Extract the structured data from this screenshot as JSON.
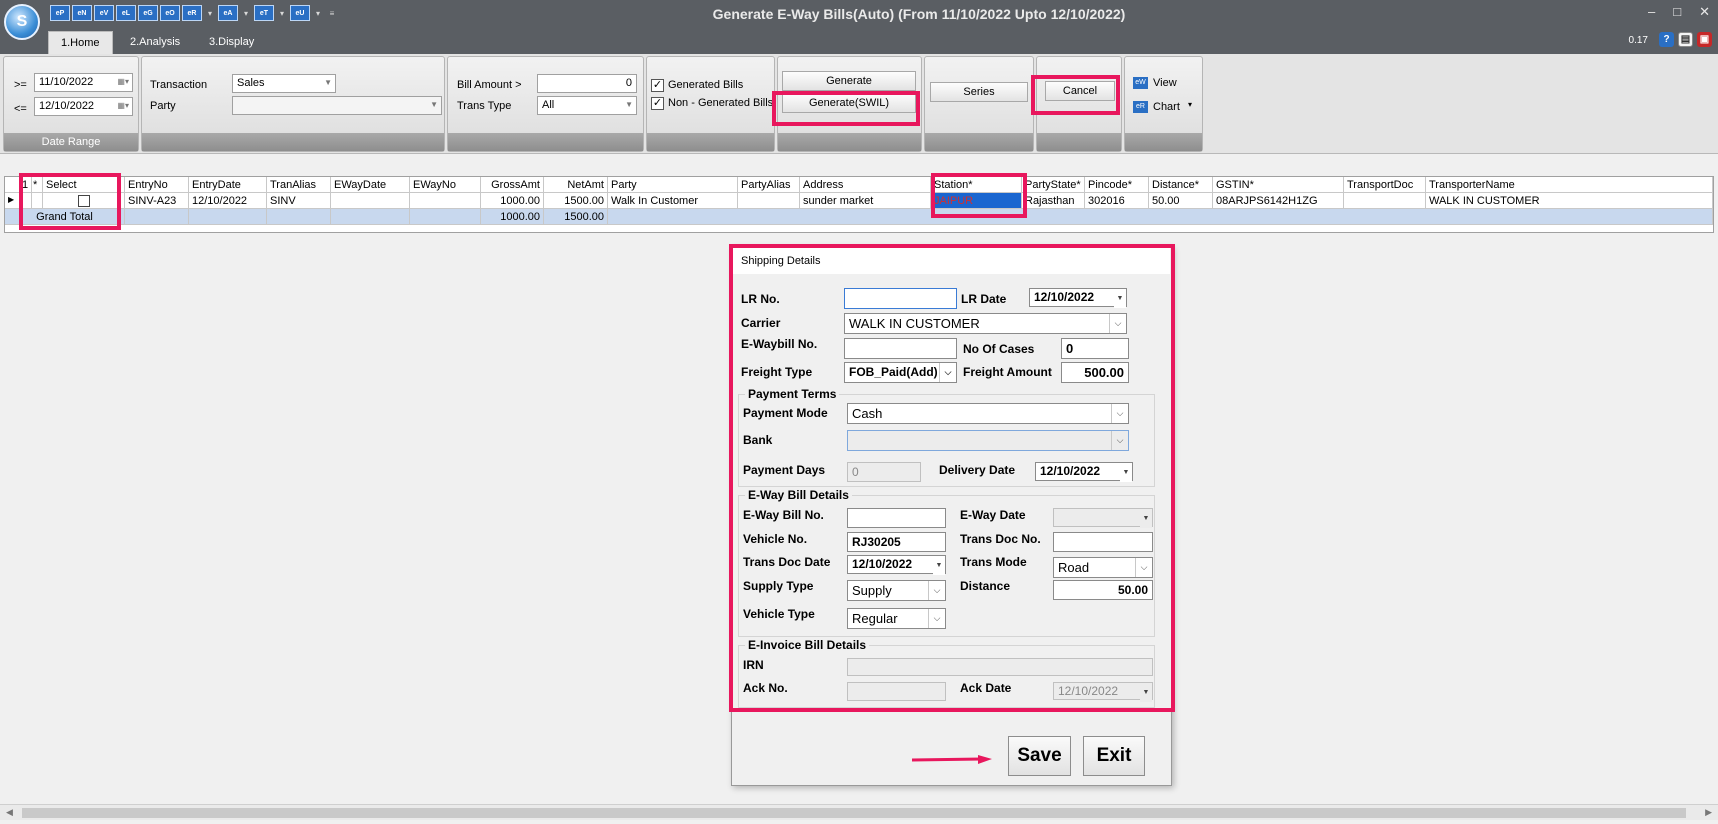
{
  "app": {
    "logo_letter": "S",
    "window_title": "Generate E-Way Bills(Auto) (From 11/10/2022 Upto 12/10/2022)",
    "version": "0.17",
    "quick_access": [
      "eP",
      "eN",
      "eV",
      "eL",
      "eG",
      "eO",
      "eR",
      "eA",
      "eT",
      "eU"
    ]
  },
  "tabs": [
    "1.Home",
    "2.Analysis",
    "3.Display"
  ],
  "ribbon": {
    "date_range": {
      "from_op": ">=",
      "from": "11/10/2022",
      "to_op": "<=",
      "to": "12/10/2022",
      "label": "Date Range"
    },
    "transaction_label": "Transaction",
    "transaction_value": "Sales",
    "party_label": "Party",
    "party_value": "",
    "bill_amount_label": "Bill Amount >",
    "bill_amount_value": "0",
    "trans_type_label": "Trans Type",
    "trans_type_value": "All",
    "generated_label": "Generated Bills",
    "non_generated_label": "Non - Generated Bills",
    "check_mark": "✓",
    "generate_label": "Generate",
    "generate_swil_label": "Generate(SWIL)",
    "series_label": "Series",
    "cancel_label": "Cancel",
    "view_label": "View",
    "chart_label": "Chart"
  },
  "grid": {
    "row_marker": "1",
    "star": "*",
    "columns": [
      "Select",
      "EntryNo",
      "EntryDate",
      "TranAlias",
      "EWayDate",
      "EWayNo",
      "GrossAmt",
      "NetAmt",
      "Party",
      "PartyAlias",
      "Address",
      "Station*",
      "PartyState*",
      "Pincode*",
      "Distance*",
      "GSTIN*",
      "TransportDoc",
      "TransporterName"
    ],
    "row": {
      "entry_no": "SINV-A23",
      "entry_date": "12/10/2022",
      "tran_alias": "SINV",
      "eway_date": "",
      "eway_no": "",
      "gross_amt": "1000.00",
      "net_amt": "1500.00",
      "party": "Walk In Customer",
      "party_alias": "",
      "address": "sunder market",
      "station": "JAIPUR",
      "party_state": "Rajasthan",
      "pincode": "302016",
      "distance": "50.00",
      "gstin": "08ARJPS6142H1ZG",
      "transport_doc": "",
      "transporter_name": "WALK IN CUSTOMER"
    },
    "grand_total": {
      "label": "Grand Total",
      "gross": "1000.00",
      "net": "1500.00"
    }
  },
  "dialog": {
    "title": "Shipping Details",
    "lr_no_label": "LR No.",
    "lr_no": "",
    "lr_date_label": "LR Date",
    "lr_date": "12/10/2022",
    "carrier_label": "Carrier",
    "carrier": "WALK IN CUSTOMER",
    "ewaybill_no_label": "E-Waybill No.",
    "ewaybill_no": "",
    "no_of_cases_label": "No Of Cases",
    "no_of_cases": "0",
    "freight_type_label": "Freight Type",
    "freight_type": "FOB_Paid(Add)",
    "freight_amount_label": "Freight Amount",
    "freight_amount": "500.00",
    "payment_terms": {
      "legend": "Payment Terms",
      "mode_label": "Payment Mode",
      "mode": "Cash",
      "bank_label": "Bank",
      "bank": "",
      "days_label": "Payment Days",
      "days": "0",
      "delivery_date_label": "Delivery Date",
      "delivery_date": "12/10/2022"
    },
    "eway_bill": {
      "legend": "E-Way Bill Details",
      "bill_no_label": "E-Way Bill No.",
      "bill_no": "",
      "date_label": "E-Way Date",
      "date": "",
      "vehicle_no_label": "Vehicle No.",
      "vehicle_no": "RJ30205",
      "trans_doc_no_label": "Trans Doc No.",
      "trans_doc_no": "",
      "trans_doc_date_label": "Trans Doc Date",
      "trans_doc_date": "12/10/2022",
      "trans_mode_label": "Trans Mode",
      "trans_mode": "Road",
      "supply_type_label": "Supply Type",
      "supply_type": "Supply",
      "distance_label": "Distance",
      "distance": "50.00",
      "vehicle_type_label": "Vehicle Type",
      "vehicle_type": "Regular"
    },
    "einvoice": {
      "legend": "E-Invoice Bill Details",
      "irn_label": "IRN",
      "irn": "",
      "ack_no_label": "Ack No.",
      "ack_no": "",
      "ack_date_label": "Ack Date",
      "ack_date": "12/10/2022"
    },
    "save_label": "Save",
    "exit_label": "Exit"
  },
  "colors": {
    "highlight": "#e8175d",
    "selection": "#1a66d0",
    "titlebar": "#5a5e63"
  }
}
